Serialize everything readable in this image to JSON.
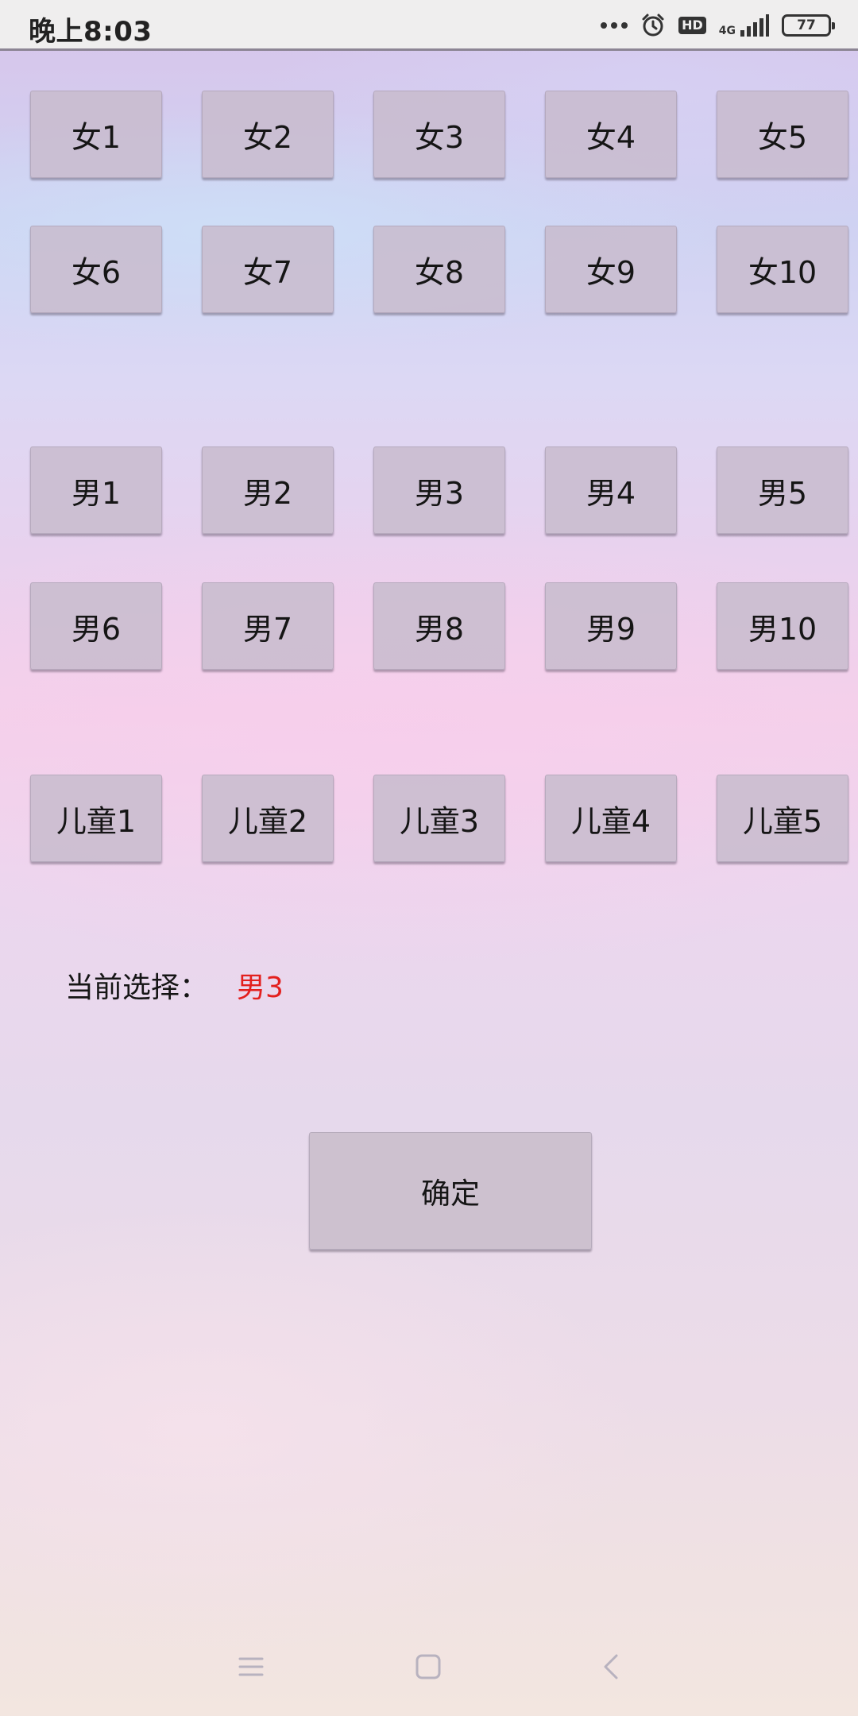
{
  "status_bar": {
    "time": "晚上8:03",
    "network": "4G",
    "hd": "HD",
    "battery": "77"
  },
  "female_buttons": [
    "女1",
    "女2",
    "女3",
    "女4",
    "女5",
    "女6",
    "女7",
    "女8",
    "女9",
    "女10"
  ],
  "male_buttons": [
    "男1",
    "男2",
    "男3",
    "男4",
    "男5",
    "男6",
    "男7",
    "男8",
    "男9",
    "男10"
  ],
  "child_buttons": [
    "儿童1",
    "儿童2",
    "儿童3",
    "儿童4",
    "儿童5"
  ],
  "selection": {
    "label": "当前选择：",
    "value": "男3",
    "value_color": "#e3201e"
  },
  "confirm_label": "确定",
  "nav_icons": [
    "menu-icon",
    "home-icon",
    "back-icon"
  ]
}
